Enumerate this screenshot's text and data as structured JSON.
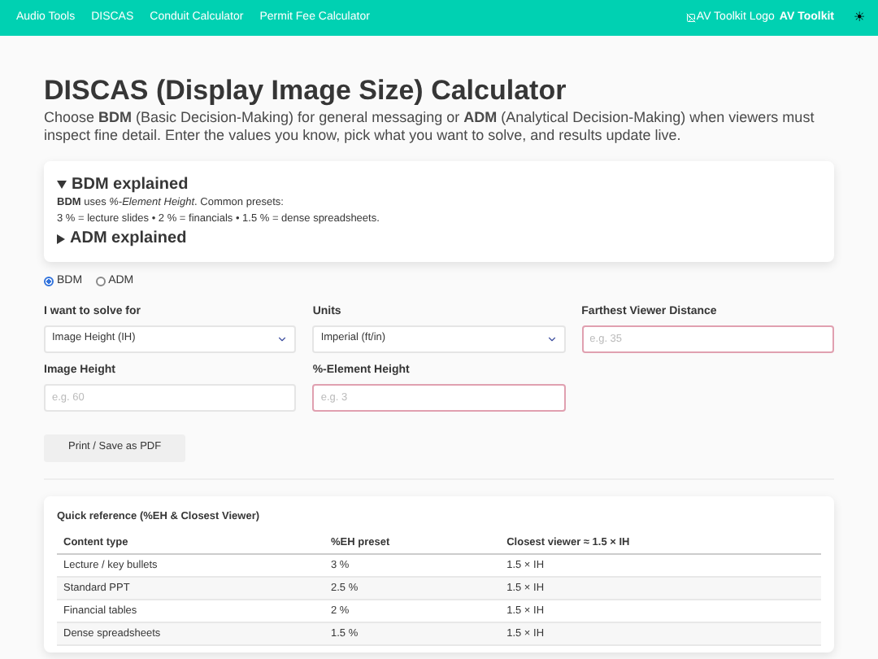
{
  "nav": {
    "links": [
      "Audio Tools",
      "DISCAS",
      "Conduit Calculator",
      "Permit Fee Calculator"
    ],
    "logo_alt": "AV Toolkit Logo",
    "brand": "AV Toolkit",
    "theme_toggle": "☀"
  },
  "title": "DISCAS (Display Image Size) Calculator",
  "intro": "Choose **BDM** (Basic Decision-Making) for general messaging or **ADM** (Analytical Decision-Making) when viewers must inspect fine detail. Enter the values you know, pick what you want to solve, and results update live.",
  "explainers": [
    {
      "title": "BDM explained",
      "expanded": true,
      "lines": [
        "**BDM** uses *%-Element Height*. Common presets:",
        "3 % = lecture slides • 2 % = financials • 1.5 % = dense spreadsheets."
      ]
    },
    {
      "title": "ADM explained",
      "expanded": false
    }
  ],
  "modes": [
    {
      "label": "BDM",
      "selected": true
    },
    {
      "label": "ADM",
      "selected": false
    }
  ],
  "fields": [
    {
      "kind": "select",
      "label": "I want to solve for",
      "value": "Image Height (IH)",
      "invalid": false
    },
    {
      "kind": "select",
      "label": "Units",
      "value": "Imperial (ft/in)",
      "invalid": false
    },
    {
      "kind": "input",
      "label": "Farthest Viewer Distance",
      "placeholder": "e.g. 35",
      "invalid": true
    },
    {
      "kind": "input",
      "label": "Image Height",
      "placeholder": "e.g. 60",
      "invalid": false
    },
    {
      "kind": "input",
      "label": "%-Element Height",
      "placeholder": "e.g. 3",
      "invalid": true
    }
  ],
  "print_button": "Print / Save as PDF",
  "reference": {
    "title": "Quick reference (%EH & Closest Viewer)",
    "columns": [
      "Content type",
      "%EH preset",
      "Closest viewer ≈ 1.5 × IH"
    ],
    "rows": [
      [
        "Lecture / key bullets",
        "3 %",
        "1.5 × IH"
      ],
      [
        "Standard PPT",
        "2.5 %",
        "1.5 × IH"
      ],
      [
        "Financial tables",
        "2 %",
        "1.5 × IH"
      ],
      [
        "Dense spreadsheets",
        "1.5 %",
        "1.5 × IH"
      ]
    ]
  }
}
